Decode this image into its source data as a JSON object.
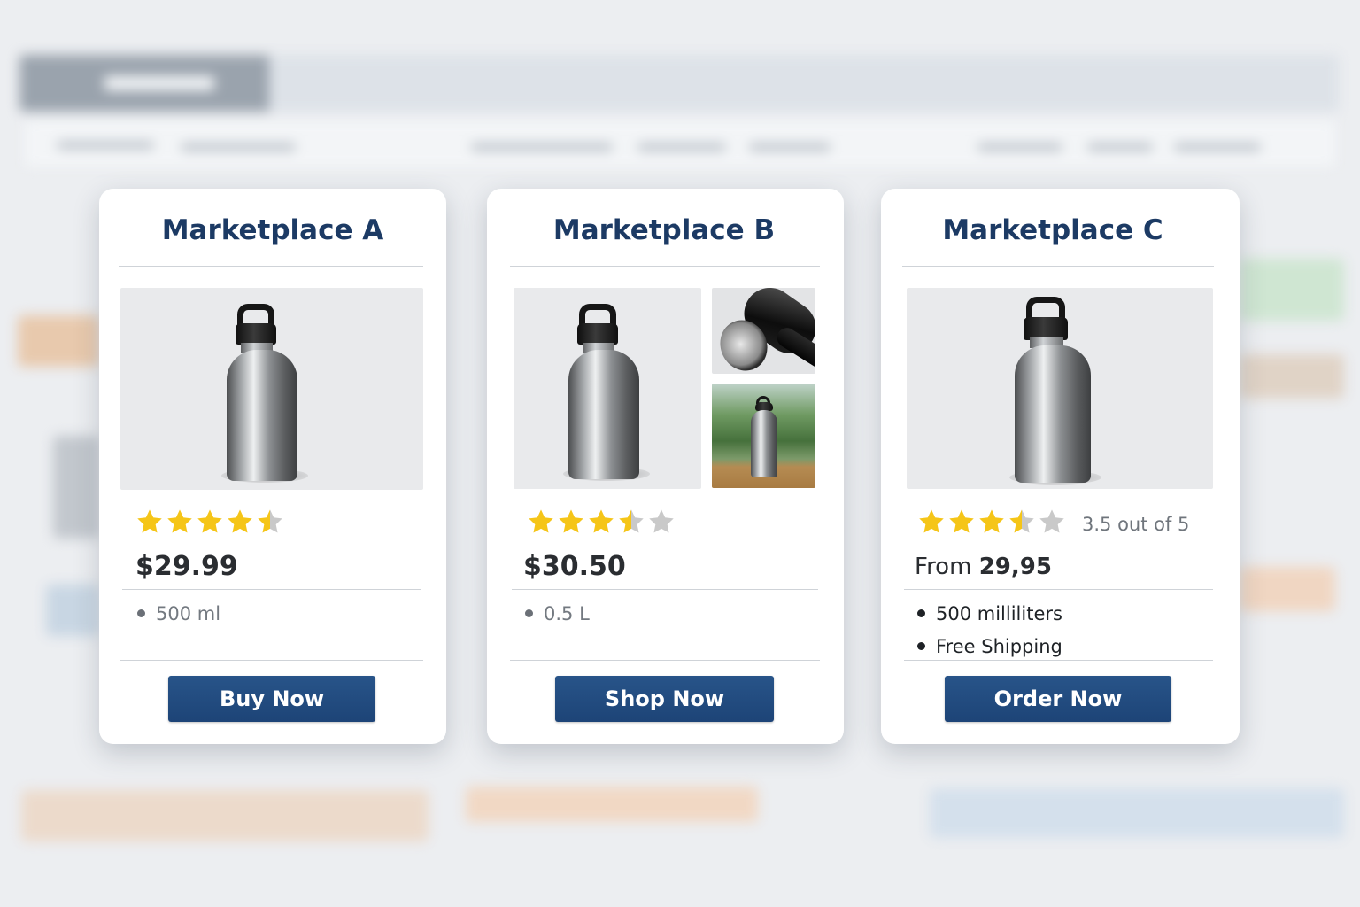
{
  "marketplaces": [
    {
      "title": "Marketplace A",
      "rating": 4.5,
      "price": "$29.99",
      "features": [
        "500 ml"
      ],
      "button": "Buy Now"
    },
    {
      "title": "Marketplace B",
      "rating": 3.5,
      "price": "$30.50",
      "features": [
        "0.5 L"
      ],
      "button": "Shop Now"
    },
    {
      "title": "Marketplace C",
      "rating": 3.5,
      "rating_text": "3.5 out of 5",
      "price_prefix": "From",
      "price": "29,95",
      "features": [
        "500 milliliters",
        "Free Shipping"
      ],
      "button": "Order Now"
    }
  ],
  "colors": {
    "title": "#1c3a64",
    "button": "#1d4477",
    "star_filled": "#f5c518",
    "star_empty": "#c9c9c9"
  },
  "icons": [
    "star-icon",
    "half-star-icon",
    "bullet-dot-icon"
  ]
}
